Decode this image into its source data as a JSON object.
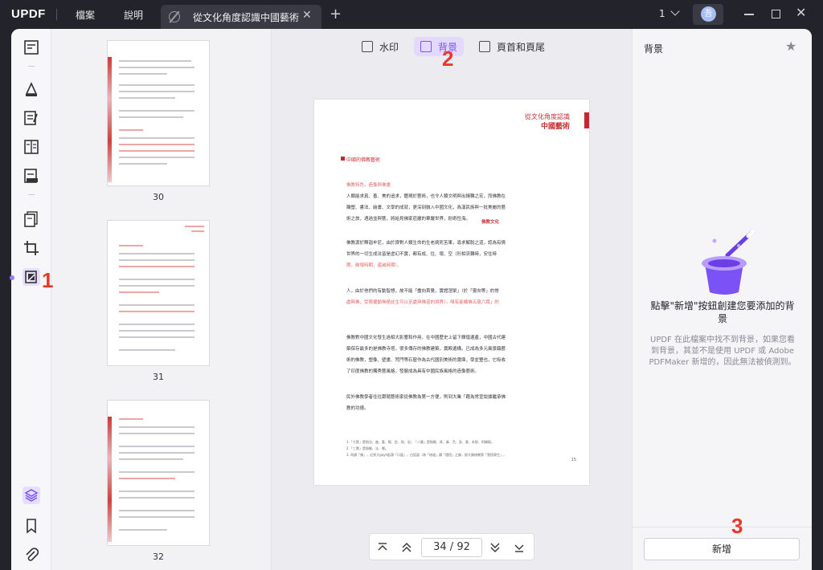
{
  "titlebar": {
    "logo": "UPDF",
    "menu": [
      "檔案",
      "說明"
    ],
    "tab_title": "從文化角度認識中國藝術",
    "page_count": "1",
    "avatar_initial": "吾"
  },
  "toolbar": {
    "watermark": "水印",
    "background": "背景",
    "header_footer": "頁首和頁尾"
  },
  "thumbnails": [
    {
      "page": "30"
    },
    {
      "page": "31"
    },
    {
      "page": "32"
    }
  ],
  "document": {
    "header_line1": "從文化角度認識",
    "header_line2": "中國藝術",
    "section_title": "中國的佛教藝術",
    "subheading": "佛教特色，造像與佛畫",
    "lines": [
      "人類能求真、善、美的追求，體現於藝術，也令人類文明與出鏈轉之宏，而佛教在",
      "雕塑、書法、繪畫、文學的成就，更深刻融入中國文化，為漢民族與一批美麗的藝",
      "術之旅，遇過並與藝，將給見佛家莊嚴的華嚴世界，耐奇性海。",
      "佛教源於釋迦牟尼，由於齊對人類生命的生老病死苦果，尋求解脫之道，認為有情",
      "世界的一切生成法皆是虛幻不實，都有成、住、壞、空（形相流轉時，安住時",
      "期，破壞時期，還滅時期）。",
      "人，由於他們的有動智想，故不能「盡向首覺，實證涅槃」（於「靈向等」的常",
      "處與佛，受限擾動無極此生可以至處與佛道的境界）。唯有能顯佛五蘊六識」的",
      "佛教對中國文化發生過相大影響和作用，在中國歷史上留下輝煌遺產，中國古代建",
      "築保存最多的是佛教寺塔，很多傳存的佛教建築，寶殿遺構，已成為多元風景臨藝",
      "術的佛教，塑像、壁畫、梵門等石窟作為古代國別美術的寶庫，學並豐也，它吸收",
      "了印度佛教的獨秀藝風格，發展成為具有中國民族風格的造像藝術。",
      "民外佛教學者往往跟隨藝術家從佛教為第一方便，則到大業「藉為常宣說據繼承佛",
      "教的功德。"
    ],
    "inline_note": "佛教文化",
    "footnote1": "1.「七覺」是指法、進、喜、輕、定、捨、念；「八識」是指眼、耳、鼻、舌、身、意、末那、阿賴耶。",
    "footnote2": "2.「三寶」是指佛、法、僧。",
    "footnote3": "3. 同調「佛」，近到大gayh起源「口語」，白話語（為「修道」讀「證悟」之佛，即大佛修教第「覺悟眾生」。",
    "page_number": "15"
  },
  "pager": {
    "current": "34",
    "separator": "/",
    "total": "92"
  },
  "right_panel": {
    "title": "背景",
    "message": "點擊\"新增\"按鈕創建您要添加的背景",
    "note": "UPDF 在此檔案中找不到背景，如果您看到背景，其並不是使用 UPDF 或 Adobe PDFMaker 新增的，因此無法被偵測到。",
    "add_button": "新增"
  },
  "annotations": {
    "step1": "1",
    "step2": "2",
    "step3": "3"
  },
  "colors": {
    "accent": "#7b52f5",
    "annotation_red": "#e8392b",
    "titlebar_bg": "#23232b"
  }
}
